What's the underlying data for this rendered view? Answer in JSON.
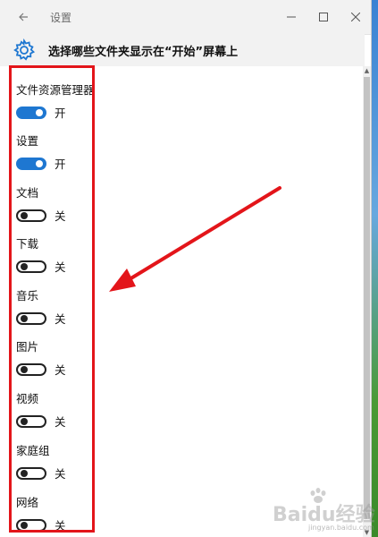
{
  "window": {
    "title": "设置"
  },
  "header": {
    "title": "选择哪些文件夹显示在“开始”屏幕上"
  },
  "settings": [
    {
      "label": "文件资源管理器",
      "state": "开"
    },
    {
      "label": "设置",
      "state": "开"
    },
    {
      "label": "文档",
      "state": "关"
    },
    {
      "label": "下载",
      "state": "关"
    },
    {
      "label": "音乐",
      "state": "关"
    },
    {
      "label": "图片",
      "state": "关"
    },
    {
      "label": "视频",
      "state": "关"
    },
    {
      "label": "家庭组",
      "state": "关"
    },
    {
      "label": "网络",
      "state": "关"
    }
  ],
  "icons": {
    "back": "back-arrow-icon",
    "minimize": "minimize-icon",
    "maximize": "maximize-icon",
    "close": "close-icon",
    "gear": "gear-icon"
  },
  "colors": {
    "accent": "#1e77d1",
    "highlight": "#e3151a",
    "toggle_off": "#222222"
  },
  "watermark": {
    "text": "Baidu经验",
    "sub": "jingyan.baidu.com"
  }
}
